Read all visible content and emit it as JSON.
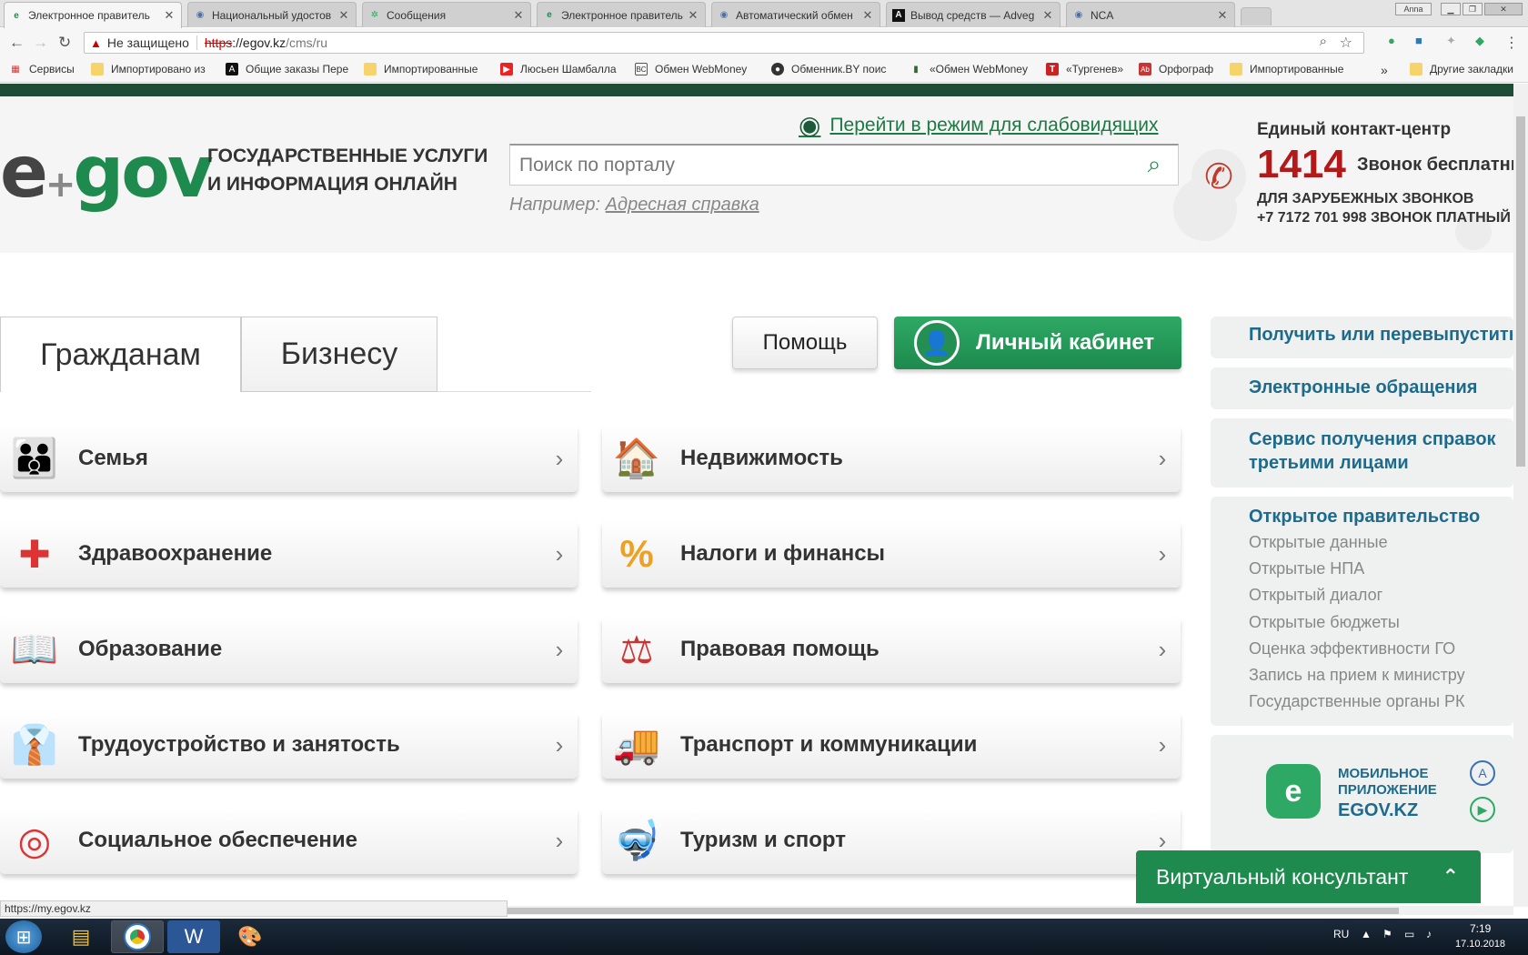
{
  "browser": {
    "tabs": [
      {
        "label": "Электронное правитель",
        "fav": "egov",
        "active": true
      },
      {
        "label": "Национальный удостов",
        "fav": "globe"
      },
      {
        "label": "Сообщения",
        "fav": "vk"
      },
      {
        "label": "Электронное правитель",
        "fav": "egov"
      },
      {
        "label": "Автоматический обмен",
        "fav": "globe"
      },
      {
        "label": "Вывод средств — Adveg",
        "fav": "A"
      },
      {
        "label": "NCA",
        "fav": "globe"
      }
    ],
    "window_user": "Anna",
    "security_label": "Не защищено",
    "url_scheme": "https",
    "url_host": "://egov.kz",
    "url_path": "/cms/ru",
    "bookmarks": [
      "Сервисы",
      "Импортировано из",
      "Общие заказы Пере",
      "Импортированные",
      "Люсьен Шамбалла",
      "Обмен WebMoney",
      "Обменник.BY поис",
      "«Обмен WebMoney",
      "«Тургенев»",
      "Орфограф",
      "Импортированные",
      "Другие закладки"
    ],
    "bookmark_more": "»",
    "status_url": "https://my.egov.kz"
  },
  "header": {
    "logo": "egov",
    "tagline_line1": "ГОСУДАРСТВЕННЫЕ УСЛУГИ",
    "tagline_line2": "И ИНФОРМАЦИЯ ОНЛАЙН",
    "low_vision_link": "Перейти в режим для слабовидящих",
    "search_placeholder": "Поиск по порталу",
    "example_prefix": "Например:",
    "example_link": "Адресная справка",
    "contact_title": "Единый контакт-центр",
    "contact_number": "1414",
    "contact_free": "Звонок бесплатный",
    "contact_foreign": "ДЛЯ ЗАРУБЕЖНЫХ ЗВОНКОВ",
    "contact_phone": "+7 7172 701 998 ЗВОНОК ПЛАТНЫЙ"
  },
  "main": {
    "tab_citizens": "Гражданам",
    "tab_business": "Бизнесу",
    "help_label": "Помощь",
    "cabinet_label": "Личный кабинет",
    "categories_left": [
      {
        "label": "Семья",
        "icon": "family-icon"
      },
      {
        "label": "Здравоохранение",
        "icon": "first-aid-kit-icon"
      },
      {
        "label": "Образование",
        "icon": "book-icon"
      },
      {
        "label": "Трудоустройство и занятость",
        "icon": "tie-icon"
      },
      {
        "label": "Социальное обеспечение",
        "icon": "lifebuoy-icon"
      }
    ],
    "categories_right": [
      {
        "label": "Недвижимость",
        "icon": "house-icon"
      },
      {
        "label": "Налоги и финансы",
        "icon": "percent-icon"
      },
      {
        "label": "Правовая помощь",
        "icon": "scales-icon"
      },
      {
        "label": "Транспорт и коммуникации",
        "icon": "truck-icon"
      },
      {
        "label": "Туризм и спорт",
        "icon": "diving-mask-icon"
      }
    ]
  },
  "sidebar": {
    "link1": "Получить или перевыпустить",
    "link2": "Электронные обращения",
    "link3_line1": "Сервис получения справок",
    "link3_line2": "третьими лицами",
    "open_gov_title": "Открытое правительство",
    "open_gov_items": [
      "Открытые данные",
      "Открытые НПА",
      "Открытый диалог",
      "Открытые бюджеты",
      "Оценка эффективности ГО",
      "Запись на прием к министру",
      "Государственные органы РК"
    ],
    "mobile_line1": "МОБИЛЬНОЕ",
    "mobile_line2": "ПРИЛОЖЕНИЕ",
    "mobile_line3": "EGOV.KZ",
    "consultant": "Виртуальный консультант"
  },
  "taskbar": {
    "lang": "RU",
    "time": "7:19",
    "date": "17.10.2018"
  },
  "colors": {
    "brand_green": "#1e8a4e",
    "dark_green": "#1f4c36",
    "link_blue": "#1e6a8c",
    "accent_red": "#b31919"
  }
}
